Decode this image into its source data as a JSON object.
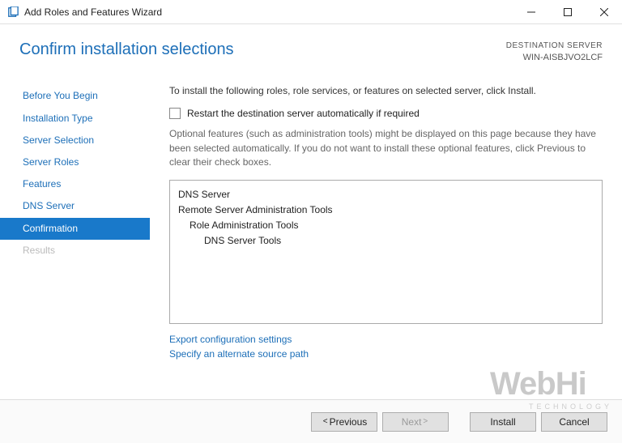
{
  "window": {
    "title": "Add Roles and Features Wizard"
  },
  "header": {
    "heading": "Confirm installation selections",
    "destination_label": "DESTINATION SERVER",
    "destination_value": "WIN-AISBJVO2LCF"
  },
  "sidebar": {
    "items": [
      {
        "label": "Before You Begin",
        "state": "enabled"
      },
      {
        "label": "Installation Type",
        "state": "enabled"
      },
      {
        "label": "Server Selection",
        "state": "enabled"
      },
      {
        "label": "Server Roles",
        "state": "enabled"
      },
      {
        "label": "Features",
        "state": "enabled"
      },
      {
        "label": "DNS Server",
        "state": "enabled"
      },
      {
        "label": "Confirmation",
        "state": "active"
      },
      {
        "label": "Results",
        "state": "disabled"
      }
    ]
  },
  "content": {
    "intro": "To install the following roles, role services, or features on selected server, click Install.",
    "restart_checkbox_label": "Restart the destination server automatically if required",
    "restart_checked": false,
    "note": "Optional features (such as administration tools) might be displayed on this page because they have been selected automatically. If you do not want to install these optional features, click Previous to clear their check boxes.",
    "selections": [
      {
        "text": "DNS Server",
        "indent": 0
      },
      {
        "text": "Remote Server Administration Tools",
        "indent": 0
      },
      {
        "text": "Role Administration Tools",
        "indent": 1
      },
      {
        "text": "DNS Server Tools",
        "indent": 2
      }
    ],
    "links": {
      "export": "Export configuration settings",
      "alt_source": "Specify an alternate source path"
    }
  },
  "footer": {
    "previous": "Previous",
    "next": "Next",
    "install": "Install",
    "cancel": "Cancel"
  },
  "watermark": {
    "text": "WebHi",
    "sub": "TECHNOLOGY"
  }
}
